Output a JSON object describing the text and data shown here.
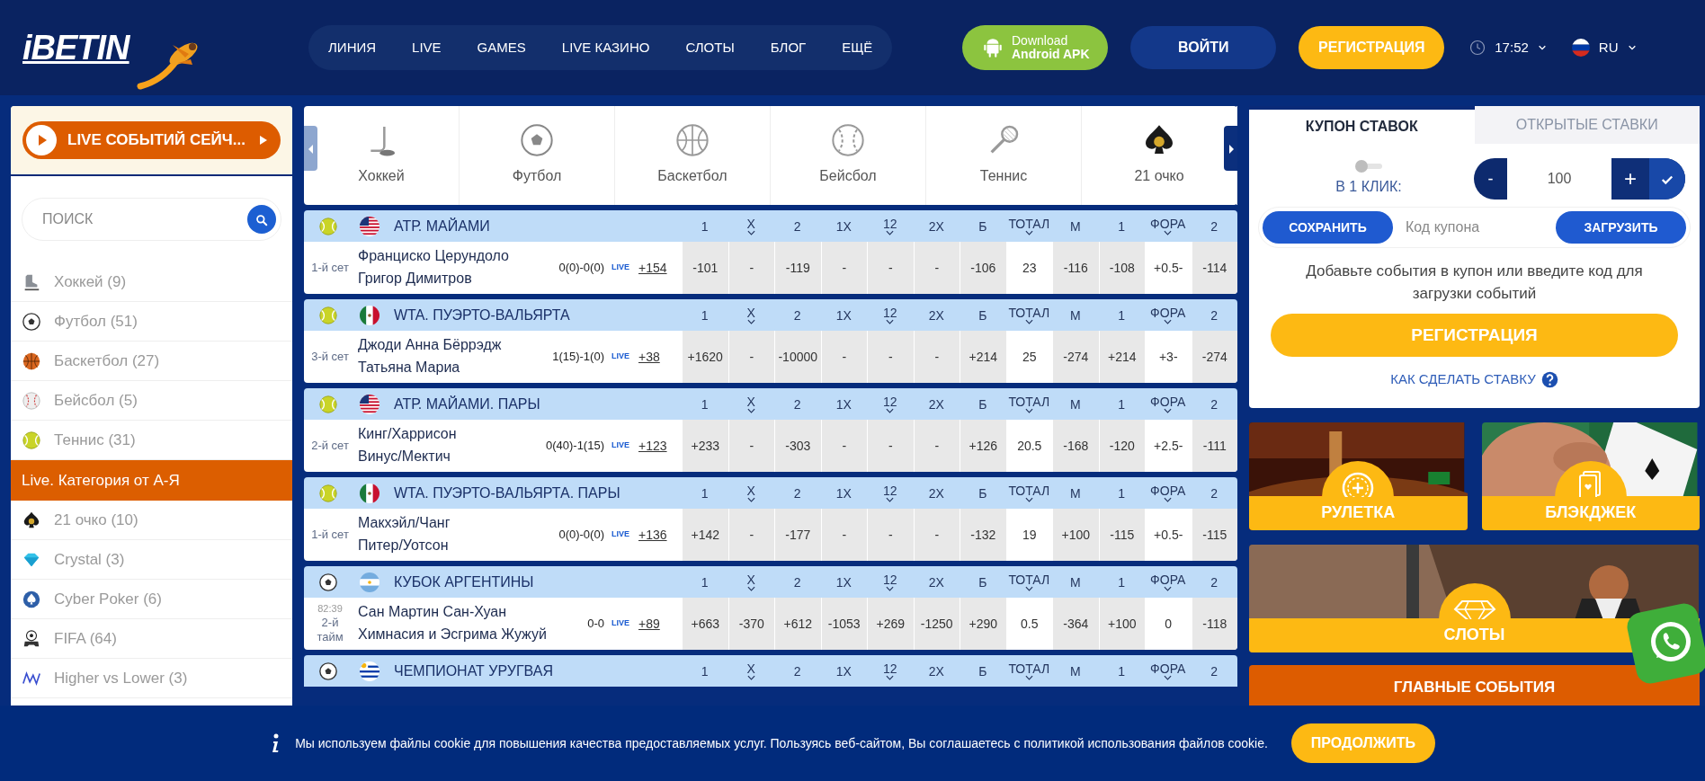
{
  "header": {
    "logo": "iBETIN",
    "nav": [
      "ЛИНИЯ",
      "LIVE",
      "GAMES",
      "LIVE КАЗИНО",
      "СЛОТЫ",
      "БЛОГ",
      "ЕЩЁ"
    ],
    "app_button": {
      "line1": "Download",
      "line2": "Android APK"
    },
    "login": "ВОЙТИ",
    "register": "РЕГИСТРАЦИЯ",
    "time": "17:52",
    "language": "RU"
  },
  "sidebar": {
    "live_button": "LIVE СОБЫТИЙ СЕЙЧ...",
    "search": {
      "placeholder": "ПОИСК"
    },
    "sports": [
      "Хоккей (9)",
      "Футбол (51)",
      "Баскетбол (27)",
      "Бейсбол (5)",
      "Теннис (31)"
    ],
    "categories_title": "Live. Категория от А-Я",
    "categories": [
      "21 очко (10)",
      "Crystal (3)",
      "Cyber Poker (6)",
      "FIFA (64)",
      "Higher vs Lower (3)"
    ]
  },
  "carousel": [
    "Хоккей",
    "Футбол",
    "Баскетбол",
    "Бейсбол",
    "Теннис",
    "21 очко"
  ],
  "leagues": [
    {
      "name": "АТР. МАЙАМИ",
      "columns": [
        {
          "label": "1",
          "caret": false
        },
        {
          "label": "X",
          "caret": true
        },
        {
          "label": "2",
          "caret": false
        },
        {
          "label": "1X",
          "caret": false
        },
        {
          "label": "12",
          "caret": true
        },
        {
          "label": "2X",
          "caret": false
        },
        {
          "label": "Б",
          "caret": false
        },
        {
          "label": "ТОТАЛ",
          "caret": true
        },
        {
          "label": "М",
          "caret": false
        },
        {
          "label": "1",
          "caret": false
        },
        {
          "label": "ФОРА",
          "caret": true
        },
        {
          "label": "2",
          "caret": false
        }
      ],
      "match": {
        "period": "1-й сет",
        "teams": [
          "Франциско Церундоло",
          "Григор Димитров"
        ],
        "score": "0(0)-0(0)",
        "live": "LIVE",
        "more": "+154",
        "odds": [
          {
            "text": "-101",
            "kind": "price"
          },
          {
            "text": "-",
            "kind": "price"
          },
          {
            "text": "-119",
            "kind": "price"
          },
          {
            "text": "-",
            "kind": "price"
          },
          {
            "text": "-",
            "kind": "price"
          },
          {
            "text": "-",
            "kind": "price"
          },
          {
            "text": "-106",
            "kind": "price"
          },
          {
            "text": "23",
            "kind": "param"
          },
          {
            "text": "-116",
            "kind": "price"
          },
          {
            "text": "-108",
            "kind": "price"
          },
          {
            "text": "+0.5-",
            "kind": "param"
          },
          {
            "text": "-114",
            "kind": "price"
          }
        ]
      }
    },
    {
      "name": "WTA. ПУЭРТО-ВАЛЬЯРТА",
      "columns": [
        {
          "label": "1",
          "caret": false
        },
        {
          "label": "X",
          "caret": true
        },
        {
          "label": "2",
          "caret": false
        },
        {
          "label": "1X",
          "caret": false
        },
        {
          "label": "12",
          "caret": true
        },
        {
          "label": "2X",
          "caret": false
        },
        {
          "label": "Б",
          "caret": false
        },
        {
          "label": "ТОТАЛ",
          "caret": true
        },
        {
          "label": "М",
          "caret": false
        },
        {
          "label": "1",
          "caret": false
        },
        {
          "label": "ФОРА",
          "caret": true
        },
        {
          "label": "2",
          "caret": false
        }
      ],
      "match": {
        "period": "3-й сет",
        "teams": [
          "Джоди Анна Бёррэдж",
          "Татьяна Мариа"
        ],
        "score": "1(15)-1(0)",
        "live": "LIVE",
        "more": "+38",
        "odds": [
          {
            "text": "+1620",
            "kind": "price"
          },
          {
            "text": "-",
            "kind": "price"
          },
          {
            "text": "-10000",
            "kind": "price"
          },
          {
            "text": "-",
            "kind": "price"
          },
          {
            "text": "-",
            "kind": "price"
          },
          {
            "text": "-",
            "kind": "price"
          },
          {
            "text": "+214",
            "kind": "price"
          },
          {
            "text": "25",
            "kind": "param"
          },
          {
            "text": "-274",
            "kind": "price"
          },
          {
            "text": "+214",
            "kind": "price"
          },
          {
            "text": "+3-",
            "kind": "param"
          },
          {
            "text": "-274",
            "kind": "price"
          }
        ]
      }
    },
    {
      "name": "АТР. МАЙАМИ. ПАРЫ",
      "columns": [
        {
          "label": "1",
          "caret": false
        },
        {
          "label": "X",
          "caret": true
        },
        {
          "label": "2",
          "caret": false
        },
        {
          "label": "1X",
          "caret": false
        },
        {
          "label": "12",
          "caret": true
        },
        {
          "label": "2X",
          "caret": false
        },
        {
          "label": "Б",
          "caret": false
        },
        {
          "label": "ТОТАЛ",
          "caret": true
        },
        {
          "label": "М",
          "caret": false
        },
        {
          "label": "1",
          "caret": false
        },
        {
          "label": "ФОРА",
          "caret": true
        },
        {
          "label": "2",
          "caret": false
        }
      ],
      "match": {
        "period": "2-й сет",
        "teams": [
          "Кинг/Харрисон",
          "Винус/Мектич"
        ],
        "score": "0(40)-1(15)",
        "live": "LIVE",
        "more": "+123",
        "odds": [
          {
            "text": "+233",
            "kind": "price"
          },
          {
            "text": "-",
            "kind": "price"
          },
          {
            "text": "-303",
            "kind": "price"
          },
          {
            "text": "-",
            "kind": "price"
          },
          {
            "text": "-",
            "kind": "price"
          },
          {
            "text": "-",
            "kind": "price"
          },
          {
            "text": "+126",
            "kind": "price"
          },
          {
            "text": "20.5",
            "kind": "param"
          },
          {
            "text": "-168",
            "kind": "price"
          },
          {
            "text": "-120",
            "kind": "price"
          },
          {
            "text": "+2.5-",
            "kind": "param"
          },
          {
            "text": "-111",
            "kind": "price"
          }
        ]
      }
    },
    {
      "name": "WTA. ПУЭРТО-ВАЛЬЯРТА. ПАРЫ",
      "columns": [
        {
          "label": "1",
          "caret": false
        },
        {
          "label": "X",
          "caret": true
        },
        {
          "label": "2",
          "caret": false
        },
        {
          "label": "1X",
          "caret": false
        },
        {
          "label": "12",
          "caret": true
        },
        {
          "label": "2X",
          "caret": false
        },
        {
          "label": "Б",
          "caret": false
        },
        {
          "label": "ТОТАЛ",
          "caret": true
        },
        {
          "label": "М",
          "caret": false
        },
        {
          "label": "1",
          "caret": false
        },
        {
          "label": "ФОРА",
          "caret": true
        },
        {
          "label": "2",
          "caret": false
        }
      ],
      "match": {
        "period": "1-й сет",
        "teams": [
          "Макхэйл/Чанг",
          "Питер/Уотсон"
        ],
        "score": "0(0)-0(0)",
        "live": "LIVE",
        "more": "+136",
        "odds": [
          {
            "text": "+142",
            "kind": "price"
          },
          {
            "text": "-",
            "kind": "price"
          },
          {
            "text": "-177",
            "kind": "price"
          },
          {
            "text": "-",
            "kind": "price"
          },
          {
            "text": "-",
            "kind": "price"
          },
          {
            "text": "-",
            "kind": "price"
          },
          {
            "text": "-132",
            "kind": "price"
          },
          {
            "text": "19",
            "kind": "param"
          },
          {
            "text": "+100",
            "kind": "price"
          },
          {
            "text": "-115",
            "kind": "price"
          },
          {
            "text": "+0.5-",
            "kind": "param"
          },
          {
            "text": "-115",
            "kind": "price"
          }
        ]
      }
    },
    {
      "name": "КУБОК АРГЕНТИНЫ",
      "columns": [
        {
          "label": "1",
          "caret": false
        },
        {
          "label": "X",
          "caret": true
        },
        {
          "label": "2",
          "caret": false
        },
        {
          "label": "1X",
          "caret": false
        },
        {
          "label": "12",
          "caret": true
        },
        {
          "label": "2X",
          "caret": false
        },
        {
          "label": "Б",
          "caret": false
        },
        {
          "label": "ТОТАЛ",
          "caret": true
        },
        {
          "label": "М",
          "caret": false
        },
        {
          "label": "1",
          "caret": false
        },
        {
          "label": "ФОРА",
          "caret": true
        },
        {
          "label": "2",
          "caret": false
        }
      ],
      "match": {
        "time": "82:39",
        "period": "2-й тайм",
        "teams": [
          "Сан Мартин Сан-Хуан",
          "Химнасия и Эсгрима Жужуй"
        ],
        "score": "0-0",
        "live": "LIVE",
        "more": "+89",
        "odds": [
          {
            "text": "+663",
            "kind": "price"
          },
          {
            "text": "-370",
            "kind": "price"
          },
          {
            "text": "+612",
            "kind": "price"
          },
          {
            "text": "-1053",
            "kind": "price"
          },
          {
            "text": "+269",
            "kind": "price"
          },
          {
            "text": "-1250",
            "kind": "price"
          },
          {
            "text": "+290",
            "kind": "price"
          },
          {
            "text": "0.5",
            "kind": "param"
          },
          {
            "text": "-364",
            "kind": "price"
          },
          {
            "text": "+100",
            "kind": "price"
          },
          {
            "text": "0",
            "kind": "param"
          },
          {
            "text": "-118",
            "kind": "price"
          }
        ]
      }
    },
    {
      "name": "ЧЕМПИОНАТ УРУГВАЯ",
      "columns": [
        {
          "label": "1",
          "caret": false
        },
        {
          "label": "X",
          "caret": true
        },
        {
          "label": "2",
          "caret": false
        },
        {
          "label": "1X",
          "caret": false
        },
        {
          "label": "12",
          "caret": true
        },
        {
          "label": "2X",
          "caret": false
        },
        {
          "label": "Б",
          "caret": false
        },
        {
          "label": "ТОТАЛ",
          "caret": true
        },
        {
          "label": "М",
          "caret": false
        },
        {
          "label": "1",
          "caret": false
        },
        {
          "label": "ФОРА",
          "caret": true
        },
        {
          "label": "2",
          "caret": false
        }
      ]
    }
  ],
  "coupon": {
    "tabs": [
      {
        "label": "КУПОН СТАВОК",
        "selected": true
      },
      {
        "label": "ОТКРЫТЫЕ СТАВКИ",
        "selected": false
      }
    ],
    "one_click": {
      "label": "В 1 КЛИК:",
      "on": false
    },
    "stake": {
      "minus": "-",
      "value": "100",
      "plus": "+"
    },
    "save": "СОХРАНИТЬ",
    "code": {
      "placeholder": "Код купона"
    },
    "load": "ЗАГРУЗИТЬ",
    "message": "Добавьте события в купон или введите код для загрузки событий",
    "register": "РЕГИСТРАЦИЯ",
    "help_link": "КАК СДЕЛАТЬ СТАВКУ"
  },
  "promos": [
    "РУЛЕТКА",
    "БЛЭКДЖЕК",
    "СЛОТЫ"
  ],
  "main_events": "ГЛАВНЫЕ СОБЫТИЯ",
  "cookie": {
    "text_before": "Мы используем файлы cookie для повышения качества предоставляемых услуг. Пользуясь веб-сайтом, Вы соглашаетесь с ",
    "link": "политикой",
    "text_after": " использования файлов cookie.",
    "button": "ПРОДОЛЖИТЬ"
  }
}
